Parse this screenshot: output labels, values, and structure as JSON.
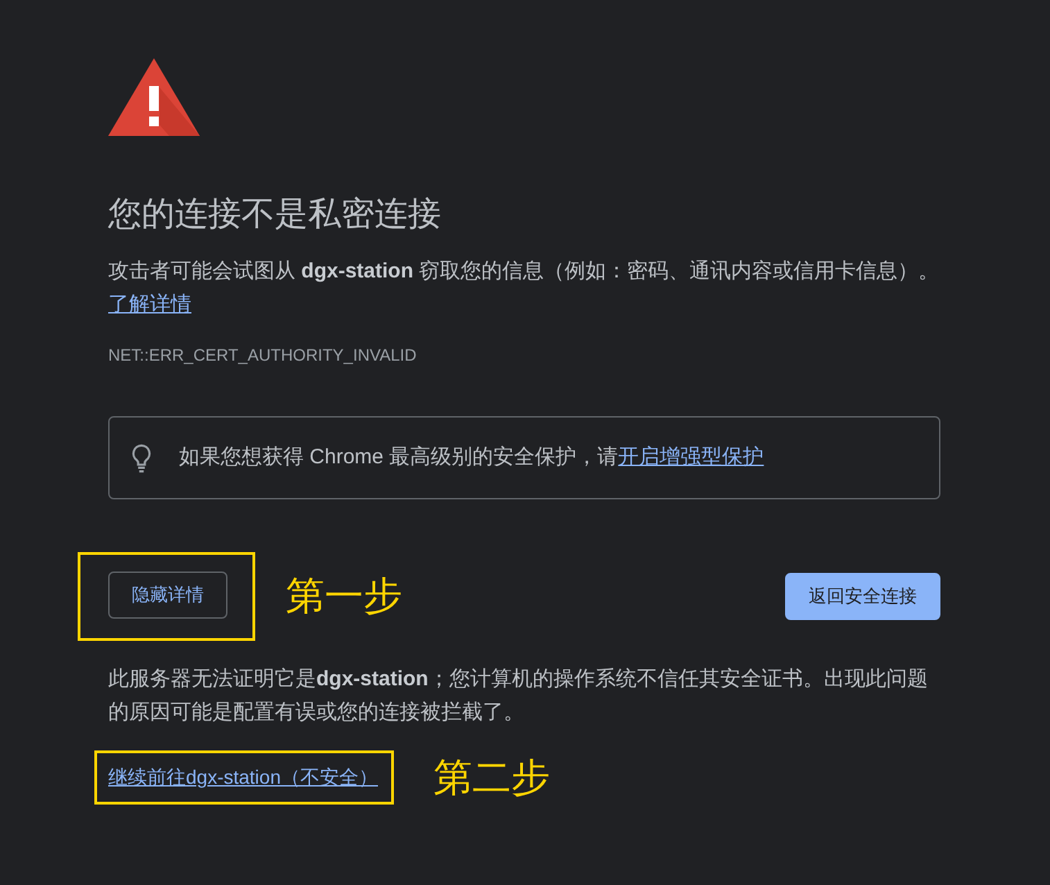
{
  "heading": "您的连接不是私密连接",
  "summary": "攻击者可能会试图从 **dgx-station** 窃取您的信息（例如：密码、通讯内容或信用卡信息）。",
  "learn_more_link": "了解详情",
  "error_code": "NET::ERR_CERT_AUTHORITY_INVALID",
  "protection_tip": {
    "text": "如果您想获得 Chrome 最高级别的安全保护，请",
    "link": "开启增强型保护"
  },
  "buttons": [
    {
      "kind": "secondary",
      "label": "隐藏详情",
      "annotation": "第一步"
    },
    {
      "kind": "primary",
      "label": "返回安全连接"
    }
  ],
  "details": {
    "text": "此服务器无法证明它是**dgx-station**；您计算机的操作系统不信任其安全证书。出现此问题的原因可能是配置有误或您的连接被拦截了。",
    "proceed_link": {
      "label": "继续前往dgx-station（不安全）",
      "annotation": "第二步"
    }
  }
}
